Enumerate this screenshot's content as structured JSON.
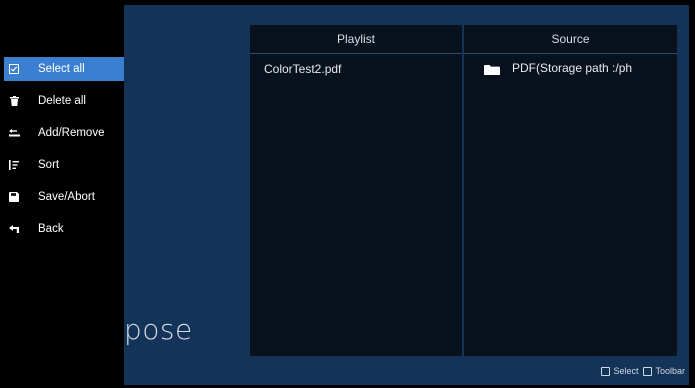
{
  "background": {
    "title_fragment": "pose"
  },
  "toolbar": {
    "items": [
      {
        "label": "Select all",
        "icon": "checkbox-icon",
        "active": true
      },
      {
        "label": "Delete all",
        "icon": "trash-icon",
        "active": false
      },
      {
        "label": "Add/Remove",
        "icon": "add-remove-icon",
        "active": false
      },
      {
        "label": "Sort",
        "icon": "sort-icon",
        "active": false
      },
      {
        "label": "Save/Abort",
        "icon": "save-icon",
        "active": false
      },
      {
        "label": "Back",
        "icon": "back-icon",
        "active": false
      }
    ]
  },
  "playlist": {
    "title": "Playlist",
    "items": [
      "ColorTest2.pdf"
    ]
  },
  "source": {
    "title": "Source",
    "items": [
      {
        "label": "PDF(Storage path :/ph",
        "icon": "folder-icon"
      }
    ]
  },
  "hints": {
    "select_label": "Select",
    "toolbar_label": "Toolbar"
  },
  "colors": {
    "accent": "#3b7fd1",
    "background_blue": "#143358",
    "panel": "#08111c"
  }
}
